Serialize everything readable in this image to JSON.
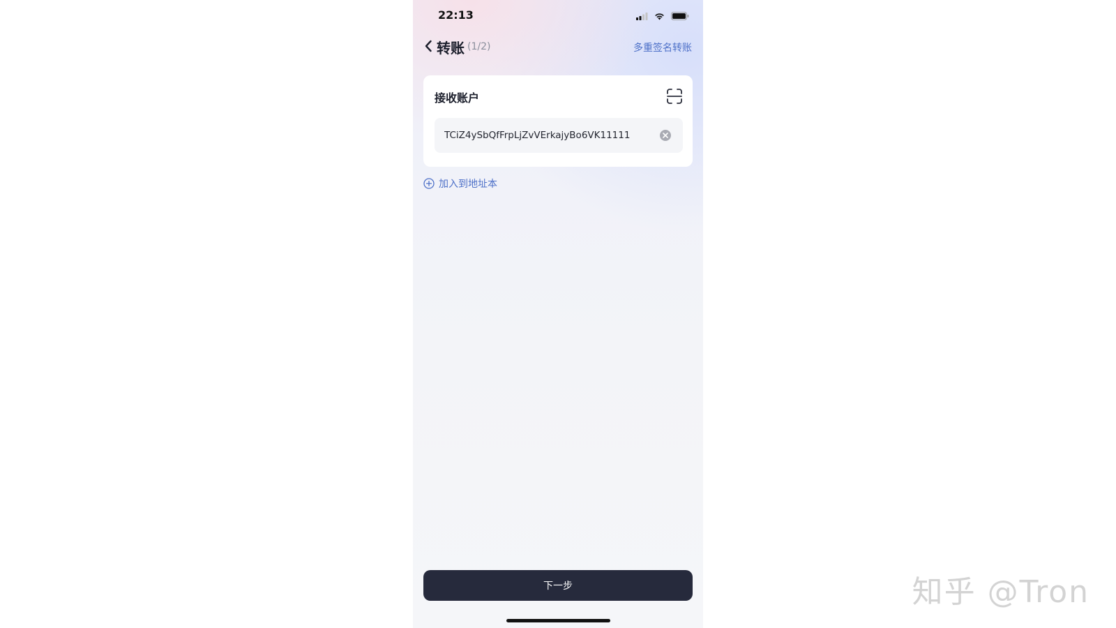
{
  "status_bar": {
    "time": "22:13",
    "icons": [
      "signal-icon",
      "wifi-icon",
      "battery-icon"
    ]
  },
  "nav": {
    "title": "转账",
    "step": "(1/2)",
    "multisig_link": "多重签名转账"
  },
  "recipient": {
    "title": "接收账户",
    "address": "TCiZ4ySbQfFrpLjZvVErkajyBo6VK11111"
  },
  "add_to_address_book": "加入到地址本",
  "next_button": "下一步",
  "watermark": "知乎 @Tron",
  "colors": {
    "accent": "#4d70c8",
    "primary_button": "#262a3c",
    "text": "#1b1e2b"
  }
}
